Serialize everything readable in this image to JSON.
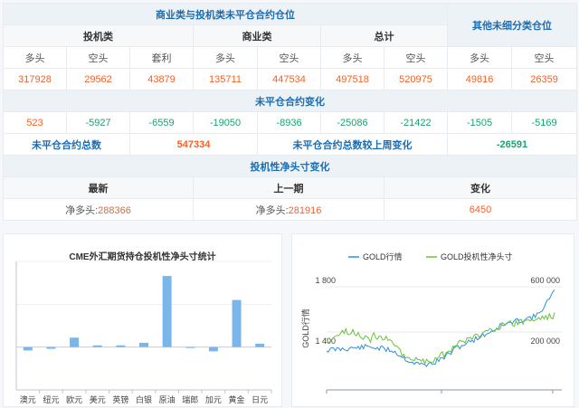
{
  "table": {
    "header_main": "商业类与投机类未平仓合约仓位",
    "header_other": "其他未细分类仓位",
    "groups": {
      "spec": "投机类",
      "comm": "商业类",
      "total": "总计"
    },
    "cols": {
      "long": "多头",
      "short": "空头",
      "spread": "套利"
    },
    "positions": {
      "spec_long": "317928",
      "spec_short": "29562",
      "spec_spread": "43879",
      "comm_long": "135711",
      "comm_short": "447534",
      "total_long": "497518",
      "total_short": "520975",
      "other_long": "49816",
      "other_short": "26359"
    },
    "change_header": "未平仓合约变化",
    "changes": [
      "523",
      "-5927",
      "-6559",
      "-19050",
      "-8936",
      "-25086",
      "-21422",
      "-1505",
      "-5169"
    ],
    "oi_total_label": "未平仓合约总数",
    "oi_total": "547334",
    "oi_change_label": "未平仓合约总数较上周变化",
    "oi_change": "-26591",
    "net_header": "投机性净头寸变化",
    "net_cols": {
      "latest": "最新",
      "prev": "上一期",
      "change": "变化"
    },
    "net_latest_label": "净多头:",
    "net_latest": "288366",
    "net_prev_label": "净多头:",
    "net_prev": "281916",
    "net_change": "6450"
  },
  "chart_data": [
    {
      "type": "bar",
      "title": "CME外汇期货持仓投机性净头寸统计",
      "categories": [
        "澳元",
        "纽元",
        "欧元",
        "美元",
        "英镑",
        "白银",
        "原油",
        "瑞郎",
        "加元",
        "黄金",
        "日元"
      ],
      "values": [
        -4,
        -2,
        11,
        2,
        2,
        5,
        83,
        0,
        -5,
        55,
        4
      ],
      "ylim": [
        -50,
        100
      ],
      "color": "#7ab6ea"
    },
    {
      "type": "line",
      "series": [
        {
          "name": "GOLD行情",
          "color": "#2f90d6",
          "axis": "left"
        },
        {
          "name": "GOLD投机性净头寸",
          "color": "#6cc23a",
          "axis": "right"
        }
      ],
      "ylabel": "GOLD行情",
      "yticks_left": [
        "1 800",
        "1 400"
      ],
      "yticks_right": [
        "600 000",
        "200 000"
      ]
    }
  ]
}
